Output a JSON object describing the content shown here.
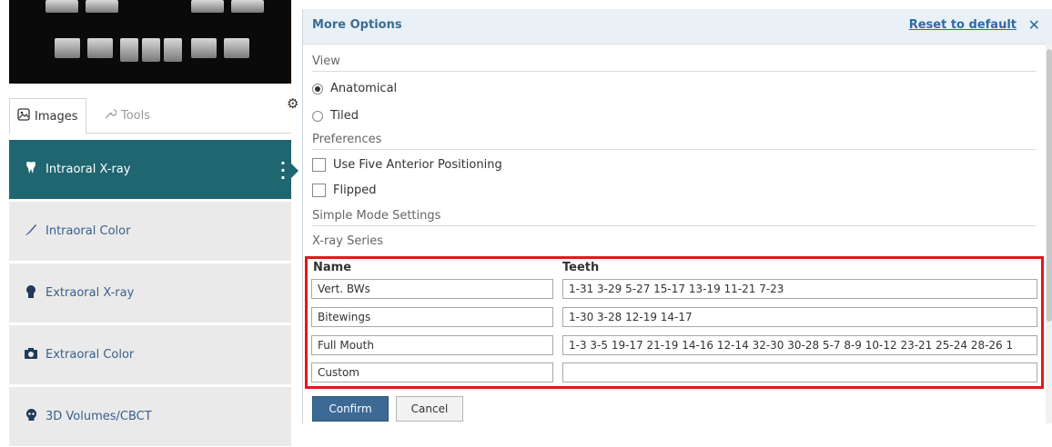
{
  "left": {
    "tabs": [
      {
        "label": "Images",
        "icon": "image-icon"
      },
      {
        "label": "Tools",
        "icon": "wrench-icon"
      }
    ],
    "nav": [
      {
        "label": "Intraoral X-ray",
        "icon": "tooth-icon",
        "active": true
      },
      {
        "label": "Intraoral Color",
        "icon": "brush-icon",
        "active": false
      },
      {
        "label": "Extraoral X-ray",
        "icon": "head-icon",
        "active": false
      },
      {
        "label": "Extraoral Color",
        "icon": "camera-icon",
        "active": false
      },
      {
        "label": "3D Volumes/CBCT",
        "icon": "skull-icon",
        "active": false
      }
    ]
  },
  "panel": {
    "title": "More Options",
    "reset_label": "Reset to default",
    "close_symbol": "✕",
    "view_label": "View",
    "view_options": [
      {
        "label": "Anatomical",
        "selected": true
      },
      {
        "label": "Tiled",
        "selected": false
      }
    ],
    "preferences_label": "Preferences",
    "preferences": [
      {
        "label": "Use Five Anterior Positioning",
        "checked": false
      },
      {
        "label": "Flipped",
        "checked": false
      }
    ],
    "simple_mode_label": "Simple Mode Settings",
    "xray_series_label": "X-ray Series",
    "series": {
      "name_header": "Name",
      "teeth_header": "Teeth",
      "rows": [
        {
          "name": "Vert. BWs",
          "teeth": "1-31 3-29 5-27 15-17 13-19 11-21 7-23"
        },
        {
          "name": "Bitewings",
          "teeth": "1-30 3-28 12-19 14-17"
        },
        {
          "name": "Full Mouth",
          "teeth": "1-3 3-5 19-17 21-19 14-16 12-14 32-30 30-28 5-7 8-9 10-12 23-21 25-24 28-26 1"
        },
        {
          "name": "Custom",
          "teeth": ""
        }
      ]
    },
    "confirm_label": "Confirm",
    "cancel_label": "Cancel"
  },
  "colors": {
    "active_nav": "#1f6670",
    "header_bg": "#e9f1f7",
    "highlight_box": "#e01919",
    "primary_button": "#3c6a94"
  }
}
